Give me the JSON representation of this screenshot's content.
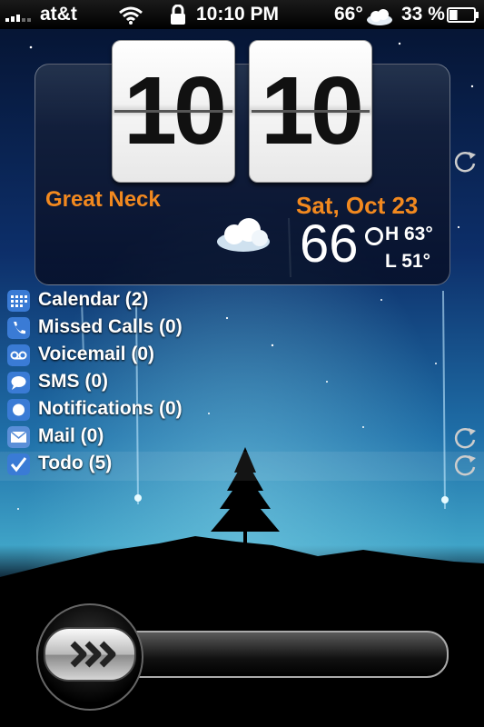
{
  "status_bar": {
    "carrier": "at&t",
    "time": "10:10 PM",
    "temperature": "66°",
    "battery": "33 %",
    "battery_level": 0.33
  },
  "widget": {
    "hours": "10",
    "minutes": "10",
    "location": "Great Neck",
    "date": "Sat, Oct 23",
    "temperature": "66",
    "high": "H 63°",
    "low": "L 51°",
    "accent_color": "#f2891f"
  },
  "notifications": [
    {
      "label": "Calendar (2)",
      "icon": "calendar-icon"
    },
    {
      "label": "Missed Calls (0)",
      "icon": "phone-icon"
    },
    {
      "label": "Voicemail (0)",
      "icon": "voicemail-icon"
    },
    {
      "label": "SMS (0)",
      "icon": "sms-icon"
    },
    {
      "label": "Notifications (0)",
      "icon": "notification-icon"
    },
    {
      "label": "Mail (0)",
      "icon": "mail-icon"
    },
    {
      "label": "Todo (5)",
      "icon": "checkmark-icon"
    }
  ]
}
